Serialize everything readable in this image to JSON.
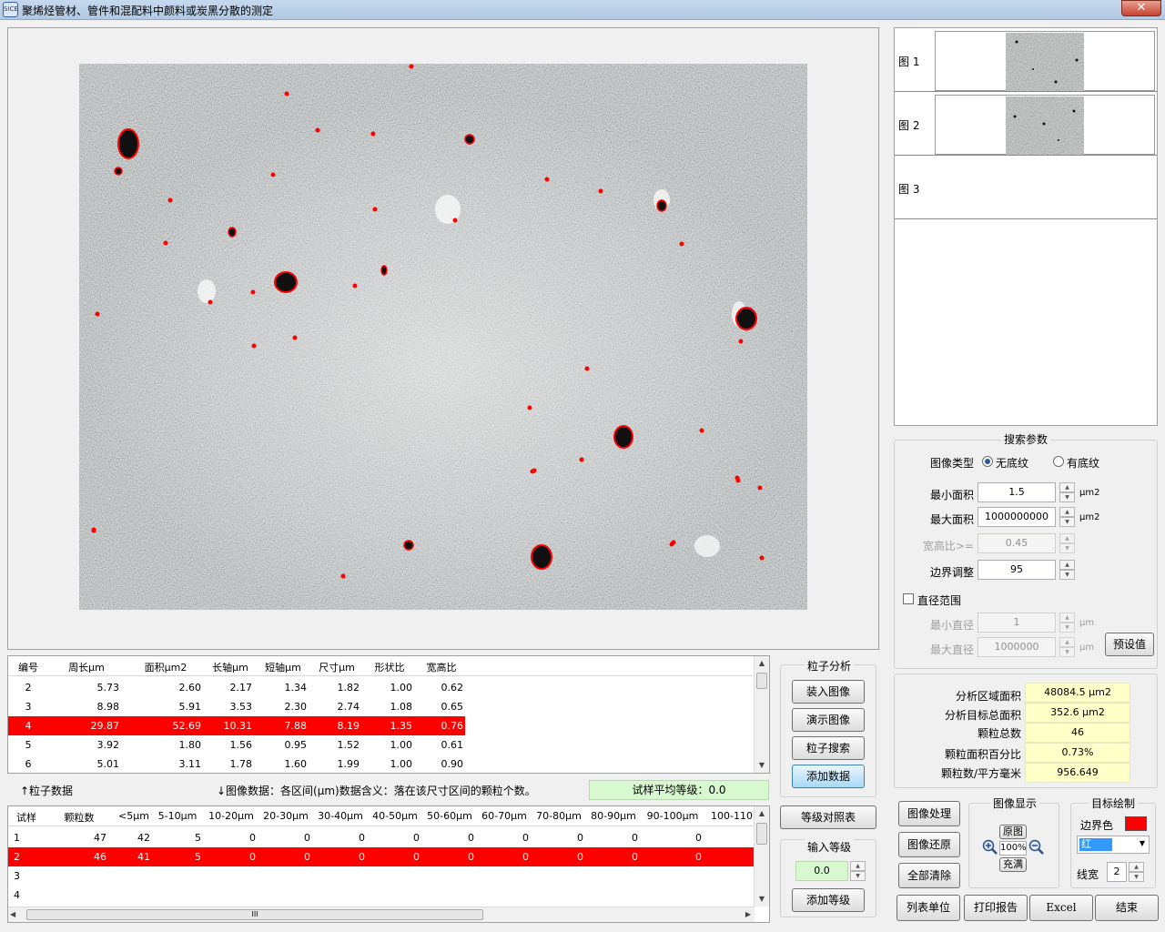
{
  "window": {
    "title": "聚烯烃管材、管件和混配料中颜料或炭黑分散的测定",
    "icon_text": "SICE",
    "close": "✕"
  },
  "particle_table": {
    "headers": [
      "编号",
      "周长μm",
      "面积μm2",
      "长轴μm",
      "短轴μm",
      "尺寸μm",
      "形状比",
      "宽高比"
    ],
    "rows": [
      [
        "2",
        "5.73",
        "2.60",
        "2.17",
        "1.34",
        "1.82",
        "1.00",
        "0.62"
      ],
      [
        "3",
        "8.98",
        "5.91",
        "3.53",
        "2.30",
        "2.74",
        "1.08",
        "0.65"
      ],
      [
        "4",
        "29.87",
        "52.69",
        "10.31",
        "7.88",
        "8.19",
        "1.35",
        "0.76"
      ],
      [
        "5",
        "3.92",
        "1.80",
        "1.56",
        "0.95",
        "1.52",
        "1.00",
        "0.61"
      ],
      [
        "6",
        "5.01",
        "3.11",
        "1.78",
        "1.60",
        "1.99",
        "1.00",
        "0.90"
      ]
    ],
    "selected_index": 2
  },
  "info_bar": {
    "particle_data": "↑粒子数据",
    "image_data_note": "↓图像数据：各区间(μm)数据含义：落在该尺寸区间的颗粒个数。",
    "avg_grade_label": "试样平均等级：",
    "avg_grade_value": "0.0"
  },
  "sample_table": {
    "headers": [
      "试样",
      "颗粒数",
      "<5μm",
      "5-10μm",
      "10-20μm",
      "20-30μm",
      "30-40μm",
      "40-50μm",
      "50-60μm",
      "60-70μm",
      "70-80μm",
      "80-90μm",
      "90-100μm",
      "100-110"
    ],
    "rows": [
      [
        "1",
        "47",
        "42",
        "5",
        "0",
        "0",
        "0",
        "0",
        "0",
        "0",
        "0",
        "0",
        "0"
      ],
      [
        "2",
        "46",
        "41",
        "5",
        "0",
        "0",
        "0",
        "0",
        "0",
        "0",
        "0",
        "0",
        "0"
      ],
      [
        "3",
        "",
        "",
        "",
        "",
        "",
        "",
        "",
        "",
        "",
        "",
        "",
        ""
      ],
      [
        "4",
        "",
        "",
        "",
        "",
        "",
        "",
        "",
        "",
        "",
        "",
        "",
        ""
      ]
    ],
    "selected_index": 1,
    "hscroll_thumb": "III"
  },
  "particle_analysis": {
    "title": "粒子分析",
    "buttons": [
      "装入图像",
      "演示图像",
      "粒子搜索",
      "添加数据"
    ]
  },
  "grade_table_button": "等级对照表",
  "input_grade": {
    "title": "输入等级",
    "value": "0.0",
    "add_button": "添加等级"
  },
  "thumbnails": [
    {
      "label": "图  1"
    },
    {
      "label": "图  2"
    },
    {
      "label": "图  3"
    }
  ],
  "search_params": {
    "title": "搜索参数",
    "image_type_label": "图像类型",
    "radio_no_texture": "无底纹",
    "radio_texture": "有底纹",
    "min_area_label": "最小面积",
    "min_area_value": "1.5",
    "min_area_unit": "μm2",
    "max_area_label": "最大面积",
    "max_area_value": "1000000000",
    "max_area_unit": "μm2",
    "aspect_label": "宽高比>=",
    "aspect_value": "0.45",
    "edge_label": "边界调整",
    "edge_value": "95",
    "diameter_range_label": "直径范围",
    "min_diam_label": "最小直径",
    "min_diam_value": "1",
    "min_diam_unit": "μm",
    "max_diam_label": "最大直径",
    "max_diam_value": "1000000",
    "max_diam_unit": "μm",
    "preset_button": "预设值"
  },
  "results": {
    "area_label": "分析区域面积",
    "area_value": "48084.5 μm2",
    "target_area_label": "分析目标总面积",
    "target_area_value": "352.6 μm2",
    "count_label": "颗粒总数",
    "count_value": "46",
    "percent_label": "颗粒面积百分比",
    "percent_value": "0.73%",
    "density_label": "颗粒数/平方毫米",
    "density_value": "956.649"
  },
  "left_buttons": [
    "图像处理",
    "图像还原",
    "全部清除"
  ],
  "image_display": {
    "title": "图像显示",
    "original": "原图",
    "zoom": "100%",
    "fill": "充满"
  },
  "target_draw": {
    "title": "目标绘制",
    "border_color_label": "边界色",
    "color_select": "红",
    "line_width_label": "线宽",
    "line_width_value": "2"
  },
  "bottom_buttons": [
    "列表单位",
    "打印报告",
    "Excel",
    "结束"
  ],
  "colors": {
    "selection": "#ff0000",
    "yellow_field": "#ffffc8",
    "grade_green": "#d8f8d0",
    "title_bar": "#b9cfe8"
  },
  "icons": [
    "zoom-in-icon",
    "zoom-out-icon",
    "close-icon",
    "dropdown-arrow-icon"
  ]
}
